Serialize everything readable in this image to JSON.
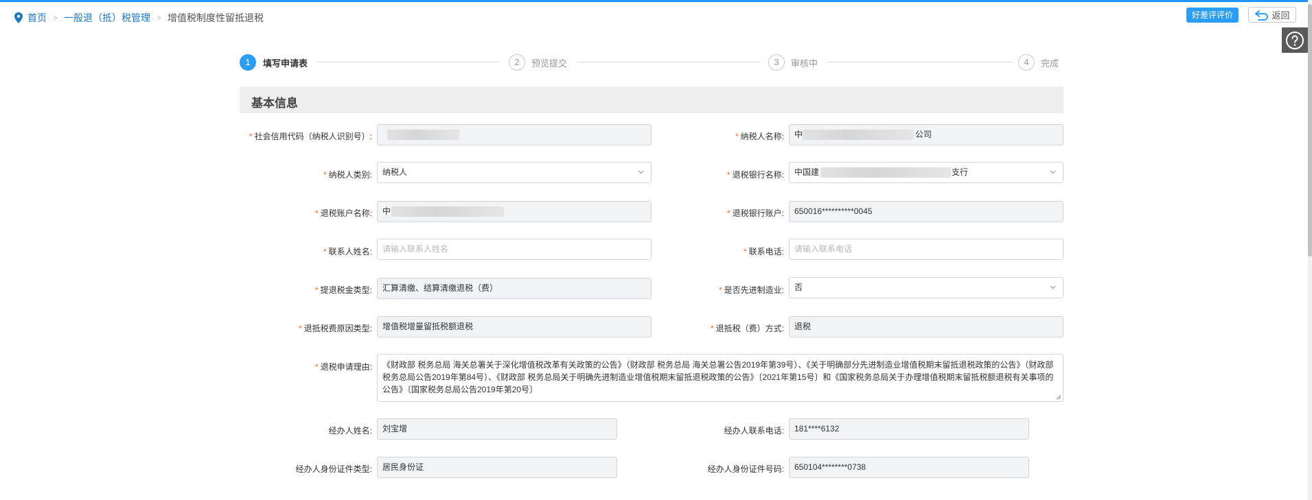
{
  "breadcrumb": {
    "home": "首页",
    "level2": "一般退（抵）税管理",
    "current": "增值税制度性留抵退税"
  },
  "header": {
    "rate_label": "好差评评价",
    "back_label": "返回"
  },
  "steps": [
    {
      "num": "1",
      "label": "填写申请表",
      "active": true
    },
    {
      "num": "2",
      "label": "预览提交",
      "active": false
    },
    {
      "num": "3",
      "label": "审核中",
      "active": false
    },
    {
      "num": "4",
      "label": "完成",
      "active": false
    }
  ],
  "section_title": "基本信息",
  "form": {
    "credit_code": {
      "label": "社会信用代码（纳税人识别号）:",
      "value": ""
    },
    "taxpayer_name": {
      "label": "纳税人名称:",
      "value_prefix": "中",
      "value_suffix": "公司"
    },
    "taxpayer_type": {
      "label": "纳税人类别:",
      "value": "纳税人"
    },
    "bank_name": {
      "label": "退税银行名称:",
      "value_prefix": "中国建",
      "value_suffix": "支行"
    },
    "account_name": {
      "label": "退税账户名称:",
      "value_prefix": "中"
    },
    "bank_account": {
      "label": "退税银行账户:",
      "value": "650016**********0045"
    },
    "contact_name": {
      "label": "联系人姓名:",
      "placeholder": "请输入联系人姓名"
    },
    "contact_phone": {
      "label": "联系电话:",
      "placeholder": "请输入联系电话"
    },
    "refund_type": {
      "label": "提退税金类型:",
      "value": "汇算清缴、结算清缴退税（费）"
    },
    "advanced_mfg": {
      "label": "是否先进制造业:",
      "value": "否"
    },
    "reason_type": {
      "label": "退抵税费原因类型:",
      "value": "增值税增量留抵税额退税"
    },
    "refund_method": {
      "label": "退抵税（费）方式:",
      "value": "退税"
    },
    "reason": {
      "label": "退税申请理由:",
      "value": "《财政部 税务总局 海关总署关于深化增值税改革有关政策的公告》（财政部 税务总局 海关总署公告2019年第39号）、《关于明确部分先进制造业增值税期末留抵退税政策的公告》（财政部 税务总局公告2019年第84号）、《财政部 税务总局关于明确先进制造业增值税期末留抵退税政策的公告》〔2021年第15号〕和《国家税务总局关于办理增值税期末留抵税额退税有关事项的公告》〔国家税务总局公告2019年第20号〕"
    },
    "agent_name": {
      "label": "经办人姓名:",
      "value": "刘宝增"
    },
    "agent_phone": {
      "label": "经办人联系电话:",
      "value": "181****6132"
    },
    "agent_id_type": {
      "label": "经办人身份证件类型:",
      "value": "居民身份证"
    },
    "agent_id_no": {
      "label": "经办人身份证件号码:",
      "value": "650104********0738"
    }
  },
  "colors": {
    "accent": "#2a9df4",
    "required": "#f56c1f",
    "link": "#1a78c2",
    "readonly_bg": "#f2f3f5"
  },
  "icons": [
    "location-pin-icon",
    "back-arrow-icon",
    "help-icon",
    "chevron-down-icon",
    "resize-grip-icon"
  ]
}
